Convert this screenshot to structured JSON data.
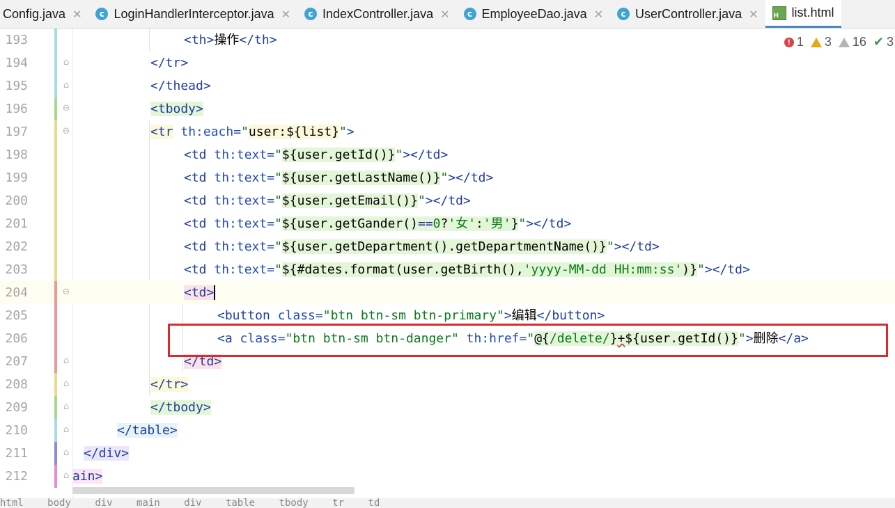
{
  "tabs": [
    {
      "label": "Config.java",
      "icon": "class-icon",
      "active": false
    },
    {
      "label": "LoginHandlerInterceptor.java",
      "icon": "class-icon",
      "active": false
    },
    {
      "label": "IndexController.java",
      "icon": "class-icon",
      "active": false
    },
    {
      "label": "EmployeeDao.java",
      "icon": "class-icon",
      "active": false
    },
    {
      "label": "UserController.java",
      "icon": "class-icon",
      "active": false
    },
    {
      "label": "list.html",
      "icon": "html-file-icon",
      "active": true
    }
  ],
  "inspections": {
    "errors": "1",
    "warnings": "3",
    "weak_warnings": "16",
    "typos": "3"
  },
  "lines": [
    {
      "no": "193",
      "text": "<th>操作</th>"
    },
    {
      "no": "194",
      "text": "</tr>"
    },
    {
      "no": "195",
      "text": "</thead>"
    },
    {
      "no": "196",
      "text": "<tbody>"
    },
    {
      "no": "197",
      "text": "<tr th:each=\"user:${list}\">"
    },
    {
      "no": "198",
      "text": "<td th:text=\"${user.getId()}\"></td>"
    },
    {
      "no": "199",
      "text": "<td th:text=\"${user.getLastName()}\"></td>"
    },
    {
      "no": "200",
      "text": "<td th:text=\"${user.getEmail()}\"></td>"
    },
    {
      "no": "201",
      "text": "<td th:text=\"${user.getGander()==0?'女':'男'}\"></td>"
    },
    {
      "no": "202",
      "text": "<td th:text=\"${user.getDepartment().getDepartmentName()}\"></td>"
    },
    {
      "no": "203",
      "text": "<td th:text=\"${#dates.format(user.getBirth(),'yyyy-MM-dd HH:mm:ss')}\"></td>"
    },
    {
      "no": "204",
      "text": "<td>"
    },
    {
      "no": "205",
      "text": "<button class=\"btn btn-sm btn-primary\">编辑</button>"
    },
    {
      "no": "206",
      "text": "<a class=\"btn btn-sm btn-danger\" th:href=\"@{/delete/}+${user.getId()}\">删除</a>"
    },
    {
      "no": "207",
      "text": "</td>"
    },
    {
      "no": "208",
      "text": "</tr>"
    },
    {
      "no": "209",
      "text": "</tbody>"
    },
    {
      "no": "210",
      "text": "</table>"
    },
    {
      "no": "211",
      "text": "</div>"
    },
    {
      "no": "212",
      "text": "ain>"
    }
  ],
  "bottom_breadcrumb": [
    "html",
    "body",
    "div",
    "main",
    "div",
    "table",
    "tbody",
    "tr",
    "td"
  ],
  "colors": {
    "tag": "#1f3da0",
    "attribute": "#244bbd",
    "string": "#0a7a1a",
    "highlight_box": "#e12828",
    "active_tab_underline": "#4a88c7"
  }
}
